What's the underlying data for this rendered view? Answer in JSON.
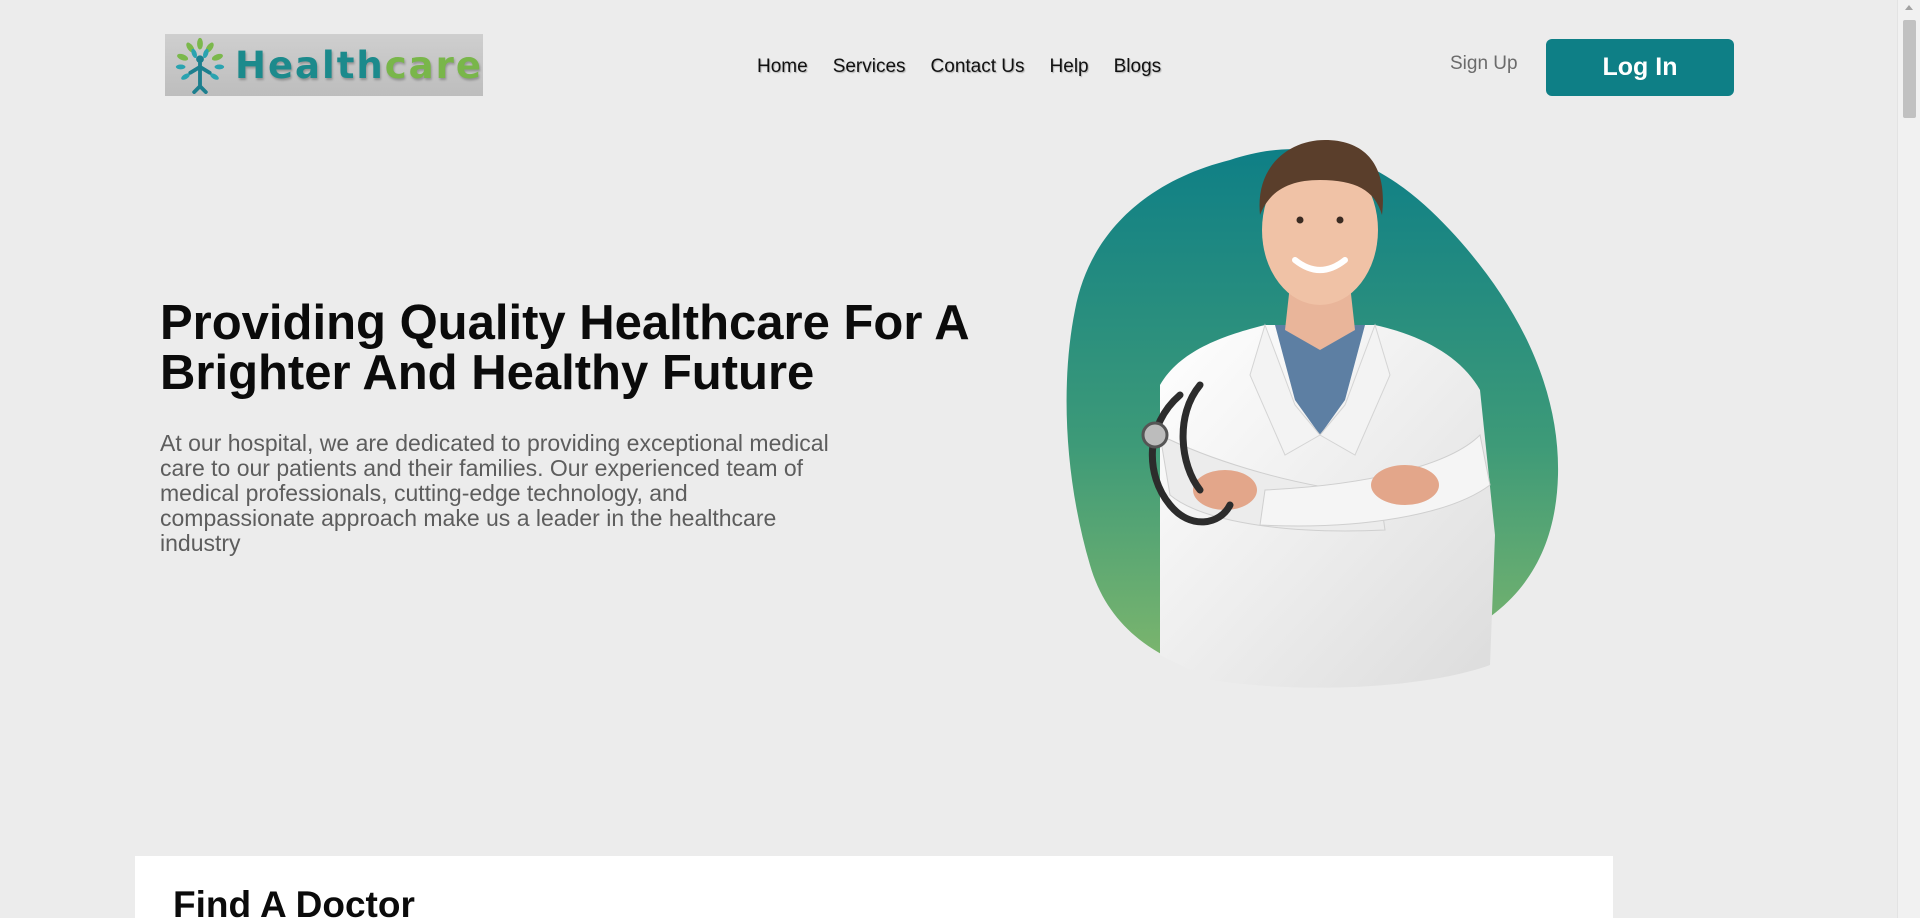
{
  "header": {
    "logo": {
      "text_part1": "Health",
      "text_part2": "care"
    },
    "nav": [
      {
        "label": "Home"
      },
      {
        "label": "Services"
      },
      {
        "label": "Contact Us"
      },
      {
        "label": "Help"
      },
      {
        "label": "Blogs"
      }
    ],
    "sign_up_label": "Sign Up",
    "log_in_label": "Log In"
  },
  "hero": {
    "title": "Providing Quality Healthcare For A Brighter And Healthy Future",
    "description": "At our hospital, we are dedicated to providing exceptional medical care to our patients and their families. Our experienced team of medical professionals, cutting-edge technology, and compassionate approach make us a leader in the healthcare industry",
    "image": "doctor-portrait"
  },
  "find_doctor": {
    "title": "Find A Doctor"
  },
  "colors": {
    "background": "#ececec",
    "brand_teal": "#0e7f86",
    "brand_green": "#79b64a",
    "blob_top": "#0e7f86",
    "blob_bottom": "#7bb56e"
  }
}
